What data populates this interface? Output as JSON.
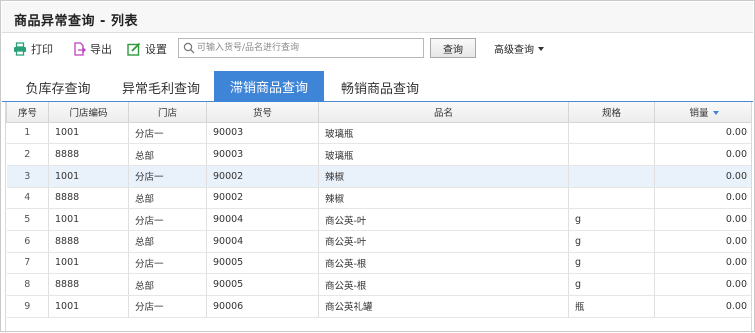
{
  "header": {
    "title": "商品异常查询 - 列表"
  },
  "toolbar": {
    "print_label": "打印",
    "export_label": "导出",
    "settings_label": "设置",
    "search_placeholder": "可输入货号/品名进行查询",
    "search_value": "",
    "query_label": "查询",
    "advanced_label": "高级查询"
  },
  "colors": {
    "print_icon": "#2aa07a",
    "export_icon": "#c040c0",
    "settings_icon": "#2e9a3c",
    "tab_active": "#3e85d8"
  },
  "tabs": [
    {
      "label": "负库存查询"
    },
    {
      "label": "异常毛利查询"
    },
    {
      "label": "滞销商品查询",
      "active": true
    },
    {
      "label": "畅销商品查询"
    }
  ],
  "table": {
    "headers": [
      "序号",
      "门店编码",
      "门店",
      "货号",
      "品名",
      "规格",
      "销量"
    ],
    "rows": [
      [
        "1",
        "1001",
        "分店一",
        "90003",
        "玻璃瓶",
        "",
        "0.00"
      ],
      [
        "2",
        "8888",
        "总部",
        "90003",
        "玻璃瓶",
        "",
        "0.00"
      ],
      [
        "3",
        "1001",
        "分店一",
        "90002",
        "辣椒",
        "",
        "0.00"
      ],
      [
        "4",
        "8888",
        "总部",
        "90002",
        "辣椒",
        "",
        "0.00"
      ],
      [
        "5",
        "1001",
        "分店一",
        "90004",
        "商公英-叶",
        "g",
        "0.00"
      ],
      [
        "6",
        "8888",
        "总部",
        "90004",
        "商公英-叶",
        "g",
        "0.00"
      ],
      [
        "7",
        "1001",
        "分店一",
        "90005",
        "商公英-根",
        "g",
        "0.00"
      ],
      [
        "8",
        "8888",
        "总部",
        "90005",
        "商公英-根",
        "g",
        "0.00"
      ],
      [
        "9",
        "1001",
        "分店一",
        "90006",
        "商公英礼罐",
        "瓶",
        "0.00"
      ]
    ]
  }
}
